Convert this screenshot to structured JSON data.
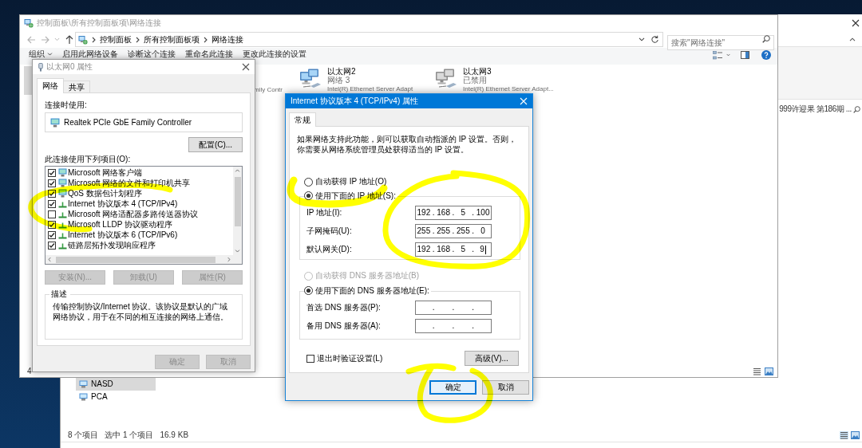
{
  "background_window": {
    "list_text": "999许迎果 第186期 ...",
    "nav_items": [
      {
        "label": "NASD",
        "selected": true
      },
      {
        "label": "PCA",
        "selected": false
      }
    ],
    "status_bar": [
      "8 个项目",
      "选中 1 个项目",
      "16.9 KB"
    ]
  },
  "explorer_window": {
    "title": "控制面板\\所有控制面板项\\网络连接",
    "active": false,
    "breadcrumb": [
      "控制面板",
      "所有控制面板项",
      "网络连接"
    ],
    "search": {
      "placeholder": "搜索\"网络连接\""
    },
    "toolbar": [
      {
        "label": "组织",
        "dropdown": true
      },
      {
        "label": "启用此网络设备",
        "dropdown": false
      },
      {
        "label": "诊断这个连接",
        "dropdown": false
      },
      {
        "label": "重命名此连接",
        "dropdown": false
      },
      {
        "label": "更改此连接的设置",
        "dropdown": false
      }
    ],
    "covered_text": "mily Contr",
    "adapters": [
      {
        "name": "以太网2",
        "status": "网络 3",
        "device": "Intel(R) Ethernet Server Adapt",
        "disabled": false
      },
      {
        "name": "以太网3",
        "status": "已禁用",
        "device": "Intel(R) Ethernet Server Adapt...",
        "disabled": true
      }
    ],
    "status_bar": "4"
  },
  "ethernet_dialog": {
    "title": "以太网0 属性",
    "active": false,
    "tabs": [
      {
        "label": "网络",
        "selected": true
      },
      {
        "label": "共享",
        "selected": false
      }
    ],
    "connect_using_label": "连接时使用:",
    "adapter": "Realtek PCIe GbE Family Controller",
    "configure_button": {
      "label": "配置(C)...",
      "disabled": false
    },
    "items_label": "此连接使用下列项目(O):",
    "items": [
      {
        "label": "Microsoft 网络客户端",
        "checked": true,
        "kind": "client"
      },
      {
        "label": "Microsoft 网络的文件和打印机共享",
        "checked": true,
        "kind": "service"
      },
      {
        "label": "QoS 数据包计划程序",
        "checked": true,
        "kind": "service"
      },
      {
        "label": "Internet 协议版本 4 (TCP/IPv4)",
        "checked": true,
        "kind": "protocol"
      },
      {
        "label": "Microsoft 网络适配器多路传送器协议",
        "checked": false,
        "kind": "protocol"
      },
      {
        "label": "Microsoft LLDP 协议驱动程序",
        "checked": true,
        "kind": "protocol"
      },
      {
        "label": "Internet 协议版本 6 (TCP/IPv6)",
        "checked": true,
        "kind": "protocol"
      },
      {
        "label": "链路层拓扑发现响应程序",
        "checked": true,
        "kind": "protocol"
      }
    ],
    "item_buttons": [
      {
        "label": "安装(N)...",
        "disabled": true
      },
      {
        "label": "卸载(U)",
        "disabled": true
      },
      {
        "label": "属性(R)",
        "disabled": true
      }
    ],
    "description_label": "描述",
    "description": "传输控制协议/Internet 协议。该协议是默认的广域网络协议，用于在不同的相互连接的网络上通信。",
    "footer_buttons": [
      {
        "label": "确定",
        "disabled": true
      },
      {
        "label": "取消",
        "disabled": true
      }
    ]
  },
  "ipv4_dialog": {
    "title": "Internet 协议版本 4 (TCP/IPv4) 属性",
    "active": true,
    "tabs": [
      {
        "label": "常规",
        "selected": true
      }
    ],
    "intro": "如果网络支持此功能，则可以获取自动指派的 IP 设置。否则，你需要从网络系统管理员处获得适当的 IP 设置。",
    "ip_mode": [
      {
        "label": "自动获得 IP 地址(O)",
        "selected": false,
        "disabled": false
      },
      {
        "label": "使用下面的 IP 地址(S):",
        "selected": true,
        "disabled": false
      }
    ],
    "ip_fields": [
      {
        "label": "IP 地址(I):",
        "octets": [
          "192",
          "168",
          "5",
          "100"
        ],
        "separators": [
          ".",
          ".",
          "."
        ],
        "focused": false
      },
      {
        "label": "子网掩码(U):",
        "octets": [
          "255",
          "255",
          "255",
          "0"
        ],
        "separators": [
          ".",
          ".",
          "."
        ],
        "focused": false
      },
      {
        "label": "默认网关(D):",
        "octets": [
          "192",
          "168",
          "5",
          "9"
        ],
        "separators": [
          ".",
          ".",
          "."
        ],
        "focused": true
      }
    ],
    "dns_mode": [
      {
        "label": "自动获得 DNS 服务器地址(B)",
        "selected": false,
        "disabled": true
      },
      {
        "label": "使用下面的 DNS 服务器地址(E):",
        "selected": true,
        "disabled": false
      }
    ],
    "dns_fields": [
      {
        "label": "首选 DNS 服务器(P):",
        "separators": [
          ".",
          ".",
          "."
        ],
        "focused": false
      },
      {
        "label": "备用 DNS 服务器(A):",
        "separators": [
          ".",
          ".",
          "."
        ],
        "focused": false
      }
    ],
    "validate": {
      "label": "退出时验证设置(L)",
      "checked": false
    },
    "advanced_button": "高级(V)...",
    "footer_buttons": [
      {
        "label": "确定",
        "default": true
      },
      {
        "label": "取消",
        "default": false
      }
    ]
  },
  "highlighter_marks": [
    {
      "kind": "loop"
    },
    {
      "kind": "hook"
    },
    {
      "kind": "loop"
    },
    {
      "kind": "loop"
    }
  ]
}
